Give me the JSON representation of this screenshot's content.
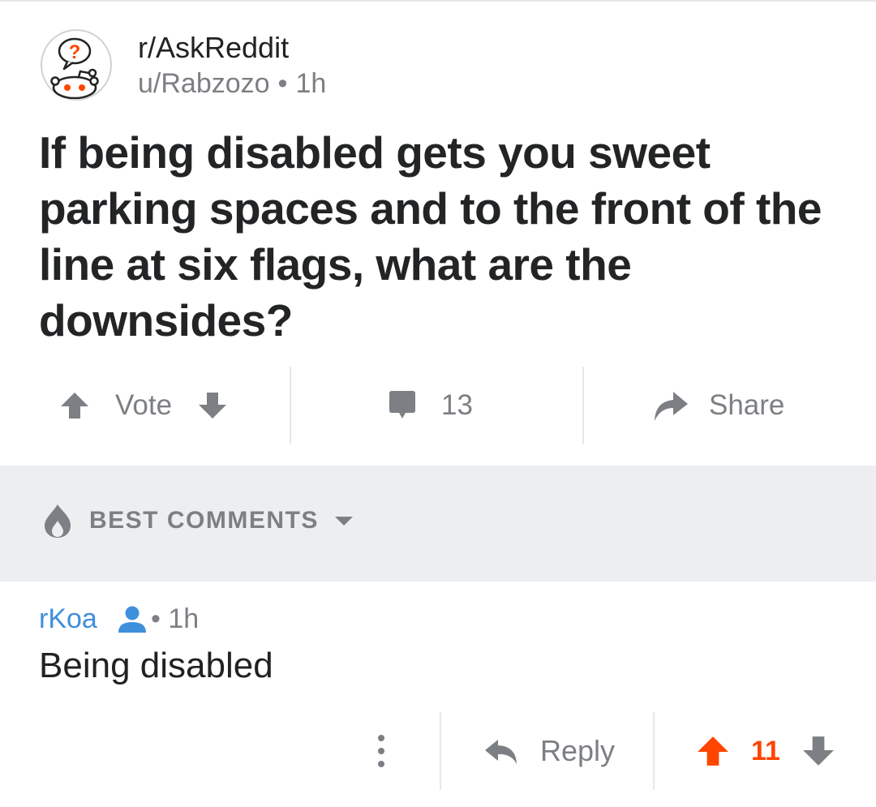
{
  "post": {
    "subreddit": "r/AskReddit",
    "author": "u/Rabzozo",
    "separator": "•",
    "age": "1h",
    "title": "If being disabled gets you sweet parking spaces and to the front of the line at six flags, what are the downsides?",
    "subreddit_icon": "askreddit-snoo-icon"
  },
  "post_actions": {
    "vote_label": "Vote",
    "comment_count": "13",
    "share_label": "Share"
  },
  "sort": {
    "label": "BEST COMMENTS",
    "icon": "flame-icon"
  },
  "comment": {
    "author": "rKoa",
    "separator": "•",
    "age": "1h",
    "body": "Being disabled",
    "reply_label": "Reply",
    "score": "11"
  },
  "colors": {
    "accent_orange": "#ff4500",
    "link_blue": "#3e8fdc",
    "muted_gray": "#7c7f83",
    "band_gray": "#edeef0"
  }
}
